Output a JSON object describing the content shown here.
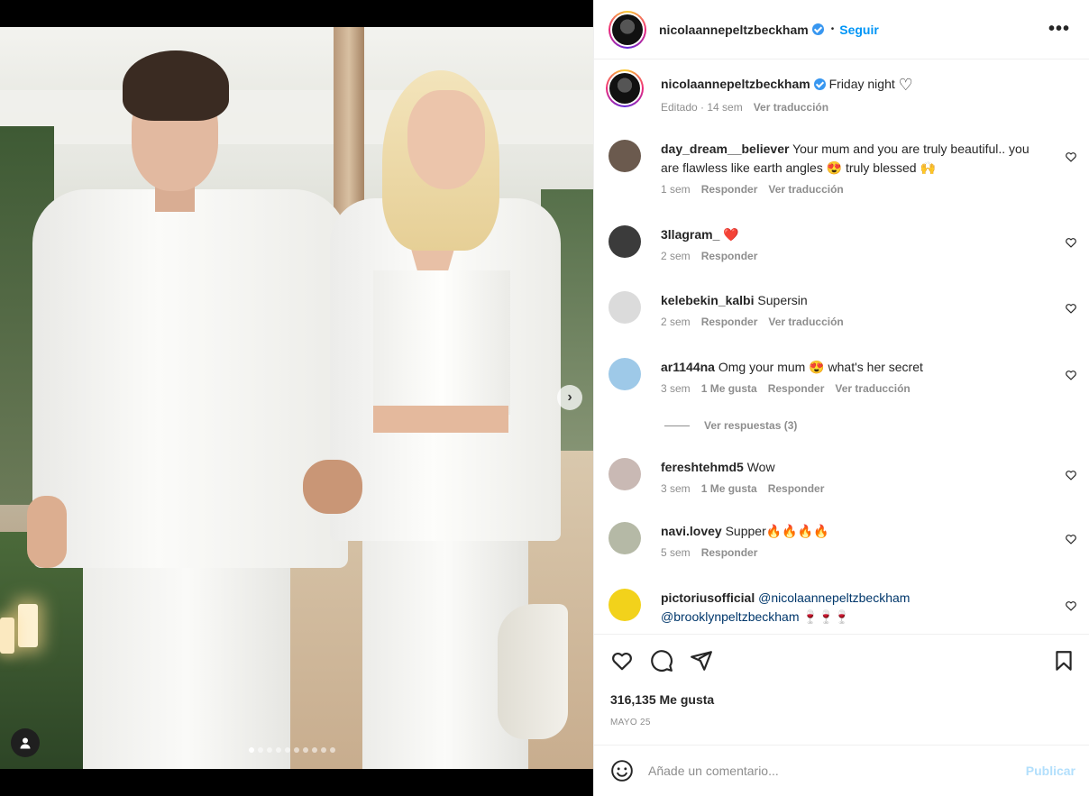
{
  "post": {
    "author": "nicolaannepeltzbeckham",
    "follow_label": "Seguir",
    "dot_separator": "•",
    "more_label": "•••",
    "caption": "Friday night",
    "caption_emoji": "♡",
    "caption_meta": "Editado · 14 sem",
    "translate_label": "Ver traducción",
    "likes": "316,135 Me gusta",
    "date": "MAYO 25",
    "carousel": {
      "total": 10,
      "current": 1,
      "next_icon": "›"
    }
  },
  "comments": [
    {
      "user": "day_dream__believer",
      "text": "Your mum and you are truly beautiful.. you are flawless like earth angles 😍 truly blessed 🙌",
      "time": "1 sem",
      "likes": "",
      "reply": "Responder",
      "translate": "Ver traducción",
      "avatar_color": "#6b5a4e"
    },
    {
      "user": "3llagram_",
      "text": "❤️",
      "time": "2 sem",
      "likes": "",
      "reply": "Responder",
      "translate": "",
      "avatar_color": "#3b3b3b"
    },
    {
      "user": "kelebekin_kalbi",
      "text": "Supersin",
      "time": "2 sem",
      "likes": "",
      "reply": "Responder",
      "translate": "Ver traducción",
      "avatar_color": "#dbdbdb"
    },
    {
      "user": "ar1144na",
      "text": "Omg your mum 😍 what's her secret",
      "time": "3 sem",
      "likes": "1 Me gusta",
      "reply": "Responder",
      "translate": "Ver traducción",
      "avatar_color": "#9ec9e8"
    },
    {
      "user": "fereshtehmd5",
      "text": "Wow",
      "time": "3 sem",
      "likes": "1 Me gusta",
      "reply": "Responder",
      "translate": "",
      "avatar_color": "#c9b9b4"
    },
    {
      "user": "navi.lovey",
      "text": "Supper🔥🔥🔥🔥",
      "time": "5 sem",
      "likes": "",
      "reply": "Responder",
      "translate": "",
      "avatar_color": "#b5b9a6"
    },
    {
      "user": "pictoriusofficial",
      "text": "",
      "mention1": "@nicolaannepeltzbeckham",
      "mention2": "@brooklynpeltzbeckham",
      "suffix": " 🍷🍷🍷",
      "avatar_color": "#f2d21b"
    }
  ],
  "replies_label": "Ver respuestas (3)",
  "composer": {
    "placeholder": "Añade un comentario...",
    "publish_label": "Publicar"
  },
  "icons": {
    "like": "heart-icon",
    "comment": "comment-icon",
    "share": "share-icon",
    "save": "bookmark-icon",
    "emoji": "emoji-icon",
    "user_tag": "user-icon"
  }
}
